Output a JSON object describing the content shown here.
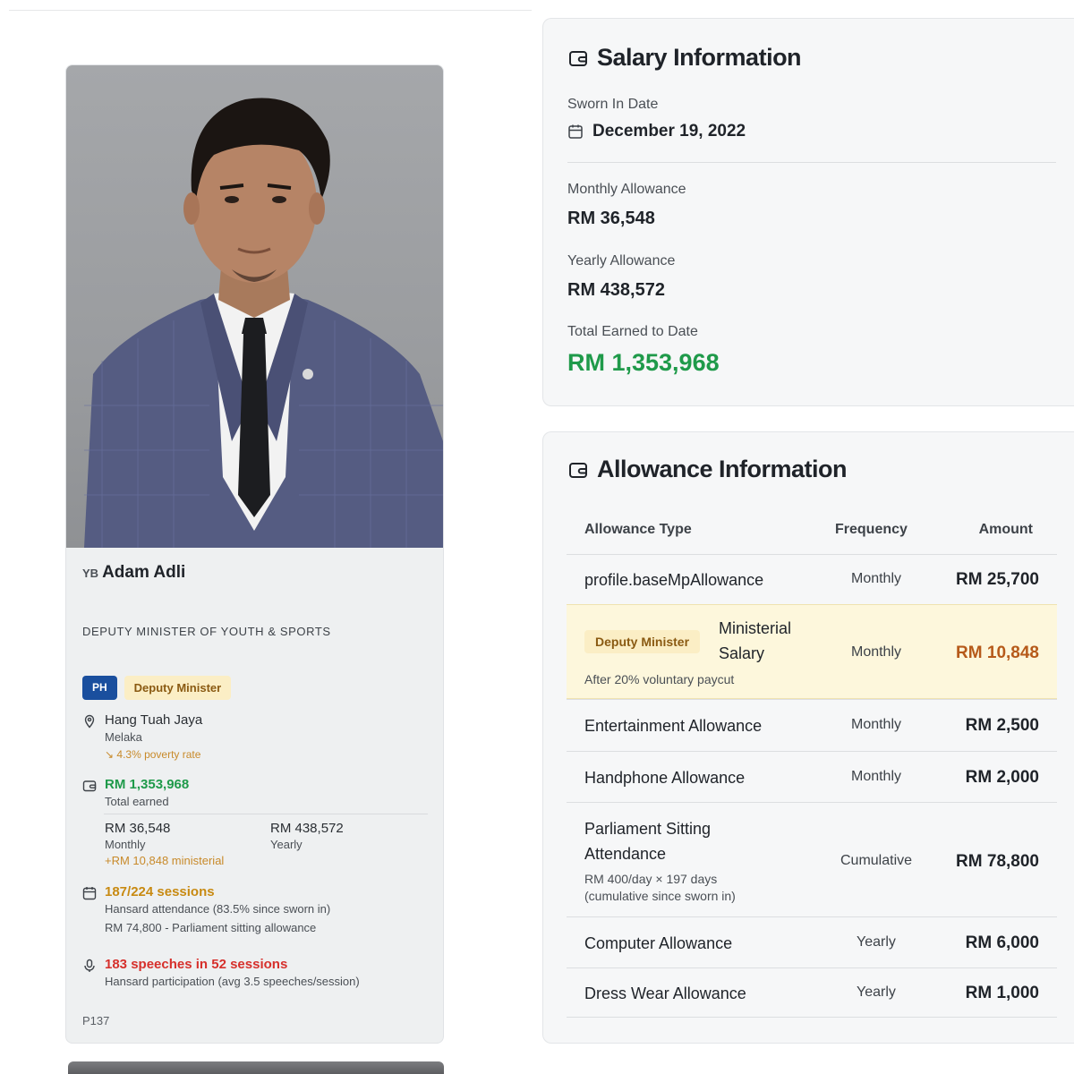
{
  "profile": {
    "name_prefix": "YB",
    "name": "Adam Adli",
    "role": "DEPUTY MINISTER OF YOUTH & SPORTS",
    "party_badge": "PH",
    "role_badge": "Deputy Minister",
    "constituency": "Hang Tuah Jaya",
    "state": "Melaka",
    "poverty_rate": "4.3% poverty rate",
    "total_earned": "RM 1,353,968",
    "total_earned_label": "Total earned",
    "monthly_value": "RM 36,548",
    "monthly_label": "Monthly",
    "monthly_extra": "+RM 10,848 ministerial",
    "yearly_value": "RM 438,572",
    "yearly_label": "Yearly",
    "sessions": "187/224 sessions",
    "sessions_detail": "Hansard attendance (83.5% since sworn in)",
    "sessions_allowance": "RM 74,800 - Parliament sitting allowance",
    "speeches": "183 speeches in 52 sessions",
    "speeches_detail": "Hansard participation (avg 3.5 speeches/session)",
    "code": "P137"
  },
  "salary": {
    "title": "Salary Information",
    "sworn_label": "Sworn In Date",
    "sworn_date": "December 19, 2022",
    "monthly_label": "Monthly Allowance",
    "monthly_value": "RM 36,548",
    "yearly_label": "Yearly Allowance",
    "yearly_value": "RM 438,572",
    "total_label": "Total Earned to Date",
    "total_value": "RM 1,353,968"
  },
  "allowance": {
    "title": "Allowance Information",
    "headers": {
      "type": "Allowance Type",
      "frequency": "Frequency",
      "amount": "Amount"
    },
    "rows": [
      {
        "type": "profile.baseMpAllowance",
        "frequency": "Monthly",
        "amount": "RM 25,700"
      },
      {
        "badge": "Deputy Minister",
        "type_line1": "Ministerial",
        "type_line2": "Salary",
        "sub": "After 20% voluntary paycut",
        "frequency": "Monthly",
        "amount": "RM 10,848"
      },
      {
        "type": "Entertainment Allowance",
        "frequency": "Monthly",
        "amount": "RM 2,500"
      },
      {
        "type": "Handphone Allowance",
        "frequency": "Monthly",
        "amount": "RM 2,000"
      },
      {
        "type_line1": "Parliament Sitting",
        "type_line2": "Attendance",
        "sub_line1": "RM 400/day × 197 days",
        "sub_line2": "(cumulative since sworn in)",
        "frequency": "Cumulative",
        "amount": "RM 78,800"
      },
      {
        "type": "Computer Allowance",
        "frequency": "Yearly",
        "amount": "RM 6,000"
      },
      {
        "type": "Dress Wear Allowance",
        "frequency": "Yearly",
        "amount": "RM 1,000"
      }
    ]
  },
  "colors": {
    "green": "#1f9a4a",
    "gold": "#c88a12",
    "red": "#d6302c",
    "party_blue": "#1a4f9e",
    "highlight": "#fdf7dc"
  }
}
